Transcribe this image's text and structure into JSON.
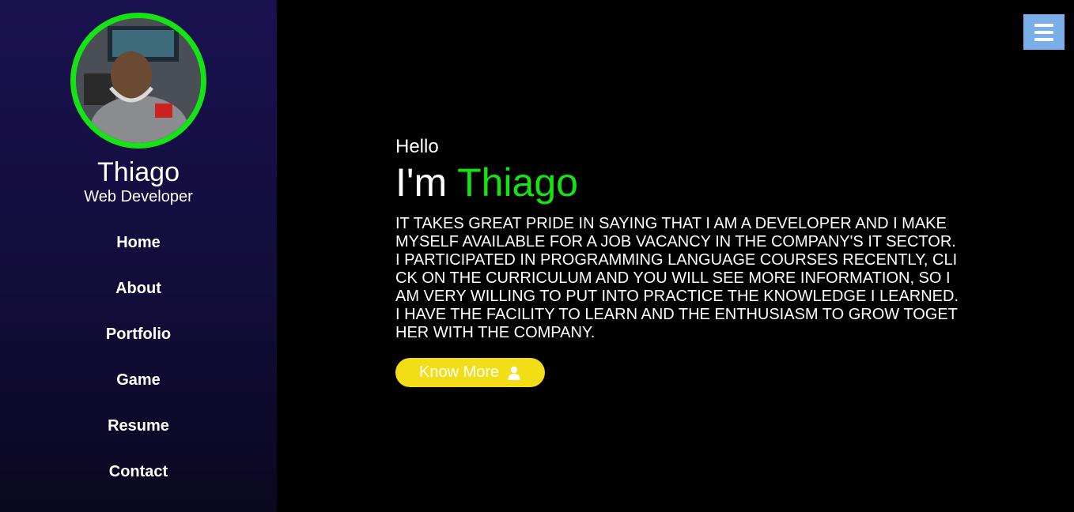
{
  "profile": {
    "name": "Thiago",
    "role": "Web Developer"
  },
  "nav": {
    "items": [
      {
        "label": "Home"
      },
      {
        "label": "About"
      },
      {
        "label": "Portfolio"
      },
      {
        "label": "Game"
      },
      {
        "label": "Resume"
      },
      {
        "label": "Contact"
      }
    ]
  },
  "hero": {
    "greeting": "Hello",
    "headline_prefix": "I'm ",
    "headline_name": "Thiago",
    "bio": "It takes great pride in saying that I am a developer and I make myself available for a job vacancy in the company's IT sector. I participated in programming language courses recently, click on the curriculum and you will see more information, so I am very willing to put into practice the knowledge I learned. I have the facility to learn and the enthusiasm to grow together with the company.",
    "cta_label": "Know More",
    "cta_icon": "user-icon"
  },
  "header": {
    "menu_icon": "hamburger-menu-icon"
  },
  "colors": {
    "accent": "#14e414",
    "cta": "#f2dd16",
    "menu_button": "#7aaee8",
    "sidebar": "#1a1150",
    "background": "#000000"
  }
}
